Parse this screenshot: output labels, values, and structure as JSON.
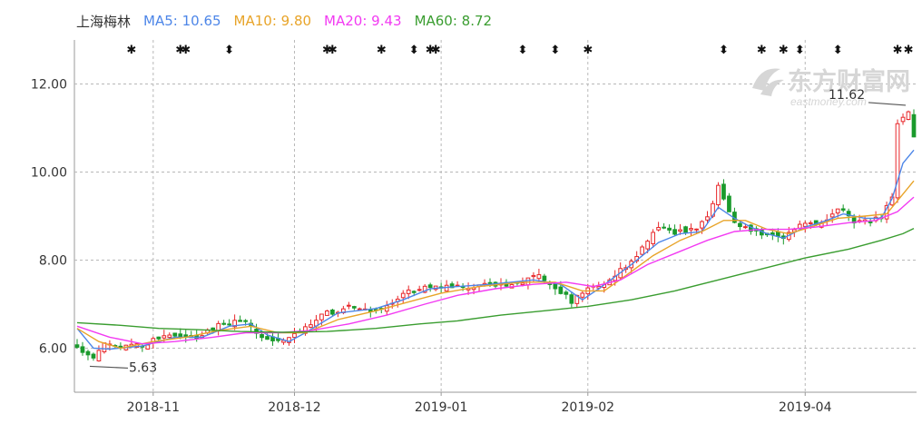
{
  "legend": {
    "stock_name": "上海梅林",
    "ma5": "MA5: 10.65",
    "ma10": "MA10: 9.80",
    "ma20": "MA20: 9.43",
    "ma60": "MA60: 8.72"
  },
  "colors": {
    "up": "#e8272a",
    "down": "#1a9a2c",
    "ma5": "#4d86e8",
    "ma10": "#e8a429",
    "ma20": "#f23af2",
    "ma60": "#3a9d30",
    "grid": "#b8b8b8",
    "axis_text": "#333333"
  },
  "watermark": {
    "cn": "东方财富网",
    "en": "eastmoney.com"
  },
  "chart_data": {
    "type": "candlestick",
    "title": "上海梅林",
    "ylim": [
      5.0,
      13.0
    ],
    "yticks": [
      "12.00",
      "10.00",
      "8.00",
      "6.00"
    ],
    "ytick_values": [
      12,
      10,
      8,
      6
    ],
    "xticks": [
      "2018-11",
      "2018-12",
      "2019-01",
      "2019-02",
      "2019-04"
    ],
    "xtick_index": [
      14,
      40,
      67,
      94,
      134
    ],
    "grid": true,
    "annotations": [
      {
        "text": "11.62",
        "kind": "max",
        "index": 153,
        "value": 11.62
      },
      {
        "text": "5.63",
        "kind": "min",
        "index": 2,
        "value": 5.63
      }
    ],
    "event_markers": [
      {
        "index": 10,
        "symbol": "✱"
      },
      {
        "index": 19,
        "symbol": "✱"
      },
      {
        "index": 20,
        "symbol": "✱"
      },
      {
        "index": 28,
        "symbol": "⬍"
      },
      {
        "index": 46,
        "symbol": "✱"
      },
      {
        "index": 47,
        "symbol": "✱"
      },
      {
        "index": 56,
        "symbol": "✱"
      },
      {
        "index": 62,
        "symbol": "⬍"
      },
      {
        "index": 65,
        "symbol": "✱"
      },
      {
        "index": 66,
        "symbol": "✱"
      },
      {
        "index": 82,
        "symbol": "⬍"
      },
      {
        "index": 88,
        "symbol": "⬍"
      },
      {
        "index": 94,
        "symbol": "✱"
      },
      {
        "index": 119,
        "symbol": "⬍"
      },
      {
        "index": 126,
        "symbol": "✱"
      },
      {
        "index": 130,
        "symbol": "✱"
      },
      {
        "index": 133,
        "symbol": "⬍"
      },
      {
        "index": 140,
        "symbol": "⬍"
      },
      {
        "index": 151,
        "symbol": "✱"
      },
      {
        "index": 153,
        "symbol": "✱"
      }
    ],
    "ohlc_waypoints": [
      [
        0,
        6.05
      ],
      [
        3,
        5.75
      ],
      [
        5,
        6.1
      ],
      [
        10,
        6.05
      ],
      [
        13,
        6.1
      ],
      [
        17,
        6.35
      ],
      [
        22,
        6.25
      ],
      [
        26,
        6.55
      ],
      [
        29,
        6.6
      ],
      [
        32,
        6.55
      ],
      [
        34,
        6.2
      ],
      [
        38,
        6.15
      ],
      [
        41,
        6.35
      ],
      [
        45,
        6.75
      ],
      [
        50,
        6.95
      ],
      [
        55,
        6.85
      ],
      [
        58,
        7.05
      ],
      [
        61,
        7.3
      ],
      [
        66,
        7.4
      ],
      [
        71,
        7.4
      ],
      [
        76,
        7.45
      ],
      [
        80,
        7.4
      ],
      [
        85,
        7.65
      ],
      [
        88,
        7.4
      ],
      [
        91,
        7.05
      ],
      [
        94,
        7.35
      ],
      [
        98,
        7.55
      ],
      [
        103,
        8.1
      ],
      [
        107,
        8.75
      ],
      [
        110,
        8.6
      ],
      [
        114,
        8.75
      ],
      [
        116,
        8.95
      ],
      [
        118,
        9.65
      ],
      [
        121,
        8.8
      ],
      [
        124,
        8.7
      ],
      [
        127,
        8.55
      ],
      [
        130,
        8.45
      ],
      [
        133,
        8.85
      ],
      [
        137,
        8.85
      ],
      [
        140,
        9.2
      ],
      [
        143,
        8.85
      ],
      [
        148,
        8.95
      ],
      [
        150,
        9.45
      ],
      [
        151,
        11.05
      ],
      [
        153,
        11.4
      ],
      [
        154,
        10.8
      ]
    ],
    "series": [
      {
        "name": "MA5",
        "points": [
          [
            0,
            6.45
          ],
          [
            3,
            6.0
          ],
          [
            6,
            5.98
          ],
          [
            12,
            6.05
          ],
          [
            18,
            6.25
          ],
          [
            23,
            6.25
          ],
          [
            28,
            6.5
          ],
          [
            32,
            6.55
          ],
          [
            35,
            6.3
          ],
          [
            39,
            6.15
          ],
          [
            42,
            6.35
          ],
          [
            48,
            6.8
          ],
          [
            55,
            6.9
          ],
          [
            60,
            7.1
          ],
          [
            65,
            7.35
          ],
          [
            70,
            7.4
          ],
          [
            76,
            7.45
          ],
          [
            84,
            7.55
          ],
          [
            89,
            7.45
          ],
          [
            93,
            7.1
          ],
          [
            96,
            7.35
          ],
          [
            102,
            7.9
          ],
          [
            107,
            8.4
          ],
          [
            111,
            8.6
          ],
          [
            115,
            8.65
          ],
          [
            118,
            9.2
          ],
          [
            121,
            8.95
          ],
          [
            124,
            8.75
          ],
          [
            127,
            8.6
          ],
          [
            130,
            8.5
          ],
          [
            134,
            8.75
          ],
          [
            138,
            8.9
          ],
          [
            141,
            9.05
          ],
          [
            145,
            8.95
          ],
          [
            148,
            8.95
          ],
          [
            150,
            9.4
          ],
          [
            152,
            10.2
          ],
          [
            154,
            10.5
          ]
        ]
      },
      {
        "name": "MA10",
        "points": [
          [
            0,
            6.45
          ],
          [
            4,
            6.15
          ],
          [
            8,
            6.0
          ],
          [
            14,
            6.15
          ],
          [
            20,
            6.25
          ],
          [
            26,
            6.4
          ],
          [
            32,
            6.5
          ],
          [
            37,
            6.35
          ],
          [
            42,
            6.35
          ],
          [
            48,
            6.65
          ],
          [
            55,
            6.85
          ],
          [
            61,
            7.05
          ],
          [
            67,
            7.25
          ],
          [
            74,
            7.4
          ],
          [
            82,
            7.5
          ],
          [
            88,
            7.5
          ],
          [
            93,
            7.3
          ],
          [
            97,
            7.3
          ],
          [
            101,
            7.65
          ],
          [
            106,
            8.1
          ],
          [
            111,
            8.45
          ],
          [
            115,
            8.65
          ],
          [
            119,
            8.9
          ],
          [
            123,
            8.9
          ],
          [
            127,
            8.7
          ],
          [
            131,
            8.6
          ],
          [
            135,
            8.75
          ],
          [
            140,
            8.95
          ],
          [
            145,
            9.0
          ],
          [
            149,
            9.05
          ],
          [
            152,
            9.5
          ],
          [
            154,
            9.8
          ]
        ]
      },
      {
        "name": "MA20",
        "points": [
          [
            0,
            6.5
          ],
          [
            6,
            6.25
          ],
          [
            12,
            6.1
          ],
          [
            18,
            6.15
          ],
          [
            25,
            6.25
          ],
          [
            31,
            6.35
          ],
          [
            37,
            6.35
          ],
          [
            43,
            6.4
          ],
          [
            50,
            6.55
          ],
          [
            57,
            6.75
          ],
          [
            64,
            7.0
          ],
          [
            70,
            7.2
          ],
          [
            77,
            7.35
          ],
          [
            84,
            7.45
          ],
          [
            90,
            7.5
          ],
          [
            95,
            7.4
          ],
          [
            100,
            7.55
          ],
          [
            105,
            7.9
          ],
          [
            111,
            8.2
          ],
          [
            116,
            8.45
          ],
          [
            121,
            8.65
          ],
          [
            126,
            8.7
          ],
          [
            131,
            8.7
          ],
          [
            136,
            8.75
          ],
          [
            142,
            8.85
          ],
          [
            147,
            8.9
          ],
          [
            151,
            9.1
          ],
          [
            154,
            9.43
          ]
        ]
      },
      {
        "name": "MA60",
        "points": [
          [
            0,
            6.58
          ],
          [
            8,
            6.52
          ],
          [
            15,
            6.45
          ],
          [
            22,
            6.42
          ],
          [
            30,
            6.38
          ],
          [
            38,
            6.36
          ],
          [
            46,
            6.38
          ],
          [
            55,
            6.45
          ],
          [
            63,
            6.55
          ],
          [
            70,
            6.62
          ],
          [
            78,
            6.75
          ],
          [
            86,
            6.85
          ],
          [
            94,
            6.95
          ],
          [
            102,
            7.1
          ],
          [
            110,
            7.3
          ],
          [
            118,
            7.55
          ],
          [
            126,
            7.8
          ],
          [
            134,
            8.05
          ],
          [
            142,
            8.25
          ],
          [
            148,
            8.45
          ],
          [
            152,
            8.6
          ],
          [
            154,
            8.72
          ]
        ]
      }
    ]
  }
}
